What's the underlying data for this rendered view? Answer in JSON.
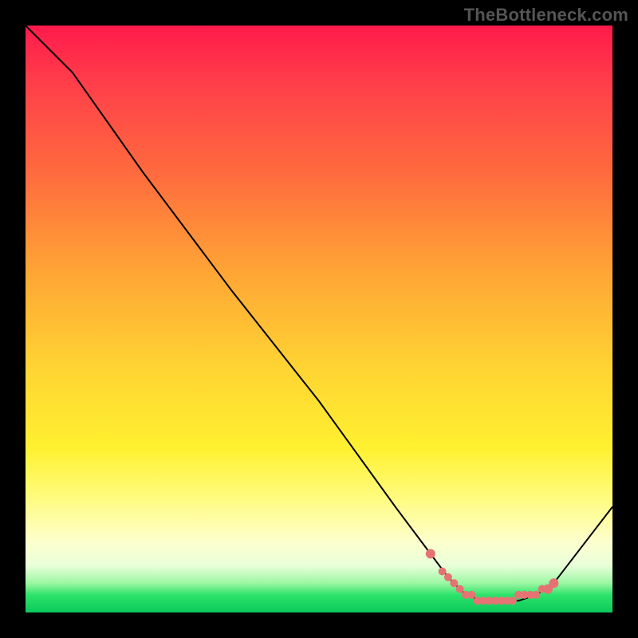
{
  "watermark": "TheBottleneck.com",
  "colors": {
    "dot": "#e57373",
    "line": "#000000"
  },
  "chart_data": {
    "type": "line",
    "title": "",
    "xlabel": "",
    "ylabel": "",
    "xlim": [
      0,
      100
    ],
    "ylim": [
      0,
      100
    ],
    "grid": false,
    "legend": false,
    "series": [
      {
        "name": "curve",
        "x": [
          0,
          8,
          20,
          35,
          50,
          63,
          69,
          72,
          75,
          78,
          81,
          84,
          87,
          90,
          100
        ],
        "y": [
          100,
          92,
          75,
          55,
          36,
          18,
          10,
          6,
          3,
          2,
          2,
          2,
          3,
          5,
          18
        ]
      }
    ],
    "markers": {
      "name": "flat-region-dots",
      "x": [
        69,
        71,
        72,
        73,
        74,
        75,
        76,
        77,
        78,
        79,
        80,
        81,
        82,
        83,
        84,
        85,
        86,
        87,
        88,
        89,
        90
      ],
      "y": [
        10,
        7,
        6,
        5,
        4,
        3,
        3,
        2,
        2,
        2,
        2,
        2,
        2,
        2,
        3,
        3,
        3,
        3,
        4,
        4,
        5
      ]
    }
  }
}
